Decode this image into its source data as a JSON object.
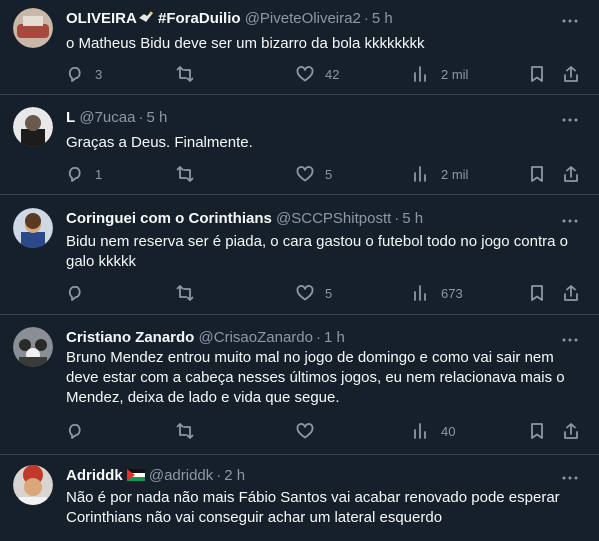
{
  "tweets": [
    {
      "name": "OLIVEIRA",
      "name_suffix": " #ForaDuilio",
      "handle": "@PiveteOliveira2",
      "time": "5 h",
      "text": "o Matheus Bidu deve ser um bizarro da bola kkkkkkkk",
      "replies": "3",
      "retweets": "",
      "likes": "42",
      "views": "2 mil"
    },
    {
      "name": "L",
      "name_suffix": "",
      "handle": "@7ucaa",
      "time": "5 h",
      "text": "Graças a Deus. Finalmente.",
      "replies": "1",
      "retweets": "",
      "likes": "5",
      "views": "2 mil"
    },
    {
      "name": "Coringuei com o Corinthians",
      "name_suffix": "",
      "handle": "@SCCPShitpostt",
      "time": "5 h",
      "text": "Bidu nem reserva ser é piada, o cara gastou o futebol todo no jogo contra o galo kkkkk",
      "replies": "",
      "retweets": "",
      "likes": "5",
      "views": "673"
    },
    {
      "name": "Cristiano Zanardo",
      "name_suffix": "",
      "handle": "@CrisaoZanardo",
      "time": "1 h",
      "text": "Bruno Mendez entrou muito mal no jogo de domingo e como vai sair nem deve estar com a cabeça nesses últimos jogos, eu nem relacionava mais o Mendez, deixa de lado e vida que segue.",
      "replies": "",
      "retweets": "",
      "likes": "",
      "views": "40"
    },
    {
      "name": "Adriddk",
      "name_suffix": "",
      "handle": "@adriddk",
      "time": "2 h",
      "text": "Não é por nada não mais Fábio Santos vai acabar renovado pode esperar Corinthians não vai conseguir achar um lateral esquerdo",
      "replies": "",
      "retweets": "",
      "likes": "",
      "views": ""
    }
  ],
  "colors": {
    "background": "#15202b",
    "text": "#f7f9f9",
    "muted": "#8b98a5",
    "divider": "#38444d"
  }
}
